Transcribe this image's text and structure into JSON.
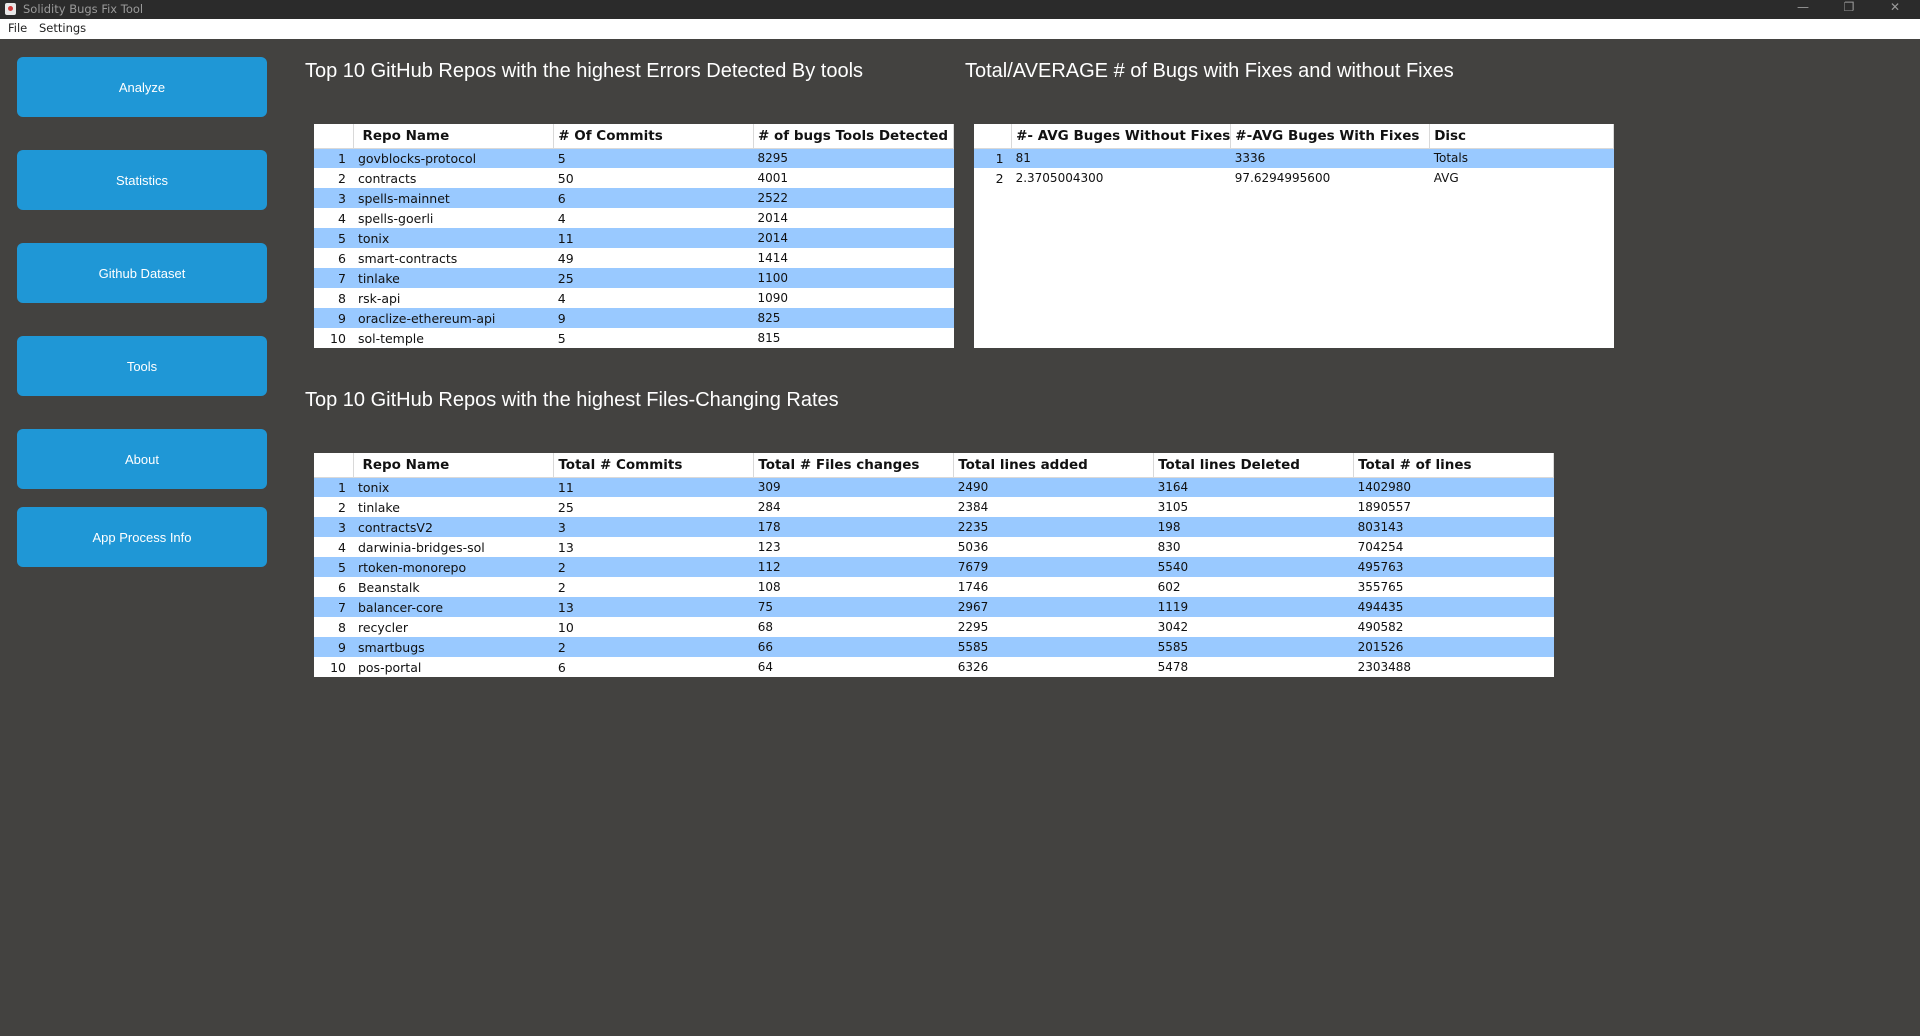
{
  "window": {
    "title": "Solidity Bugs Fix Tool",
    "min_glyph": "—",
    "max_glyph": "❐",
    "close_glyph": "✕"
  },
  "menu": {
    "file": "File",
    "settings": "Settings"
  },
  "sidebar": {
    "items": [
      {
        "label": "Analyze"
      },
      {
        "label": "Statistics"
      },
      {
        "label": "Github Dataset"
      },
      {
        "label": "Tools"
      },
      {
        "label": "About"
      },
      {
        "label": "App Process Info"
      }
    ]
  },
  "sections": {
    "errors_title": "Top 10 GitHub Repos with the highest Errors Detected By tools",
    "bugs_title": "Total/AVERAGE # of Bugs with Fixes and without Fixes",
    "files_title": "Top 10 GitHub Repos with the highest Files-Changing Rates"
  },
  "errors_table": {
    "headers": [
      "Repo Name",
      "# Of Commits",
      "# of bugs Tools Detected"
    ],
    "rows": [
      [
        "1",
        "govblocks-protocol",
        "5",
        "8295"
      ],
      [
        "2",
        "contracts",
        "50",
        "4001"
      ],
      [
        "3",
        "spells-mainnet",
        "6",
        "2522"
      ],
      [
        "4",
        "spells-goerli",
        "4",
        "2014"
      ],
      [
        "5",
        "tonix",
        "11",
        "2014"
      ],
      [
        "6",
        "smart-contracts",
        "49",
        "1414"
      ],
      [
        "7",
        "tinlake",
        "25",
        "1100"
      ],
      [
        "8",
        "rsk-api",
        "4",
        "1090"
      ],
      [
        "9",
        "oraclize-ethereum-api",
        "9",
        "825"
      ],
      [
        "10",
        "sol-temple",
        "5",
        "815"
      ]
    ]
  },
  "bugs_table": {
    "headers": [
      "#- AVG Buges Without Fixes",
      "#-AVG Buges With Fixes",
      "Disc"
    ],
    "rows": [
      [
        "1",
        "81",
        "3336",
        "Totals"
      ],
      [
        "2",
        "2.3705004300",
        "97.6294995600",
        "AVG"
      ]
    ]
  },
  "files_table": {
    "headers": [
      "Repo Name",
      "Total # Commits",
      "Total # Files changes",
      "Total lines added",
      "Total lines Deleted",
      "Total # of lines"
    ],
    "rows": [
      [
        "1",
        "tonix",
        "11",
        "309",
        "2490",
        "3164",
        "1402980"
      ],
      [
        "2",
        "tinlake",
        "25",
        "284",
        "2384",
        "3105",
        "1890557"
      ],
      [
        "3",
        "contractsV2",
        "3",
        "178",
        "2235",
        "198",
        "803143"
      ],
      [
        "4",
        "darwinia-bridges-sol",
        "13",
        "123",
        "5036",
        "830",
        "704254"
      ],
      [
        "5",
        "rtoken-monorepo",
        "2",
        "112",
        "7679",
        "5540",
        "495763"
      ],
      [
        "6",
        "Beanstalk",
        "2",
        "108",
        "1746",
        "602",
        "355765"
      ],
      [
        "7",
        "balancer-core",
        "13",
        "75",
        "2967",
        "1119",
        "494435"
      ],
      [
        "8",
        "recycler",
        "10",
        "68",
        "2295",
        "3042",
        "490582"
      ],
      [
        "9",
        "smartbugs",
        "2",
        "66",
        "5585",
        "5585",
        "201526"
      ],
      [
        "10",
        "pos-portal",
        "6",
        "64",
        "6326",
        "5478",
        "2303488"
      ]
    ]
  }
}
